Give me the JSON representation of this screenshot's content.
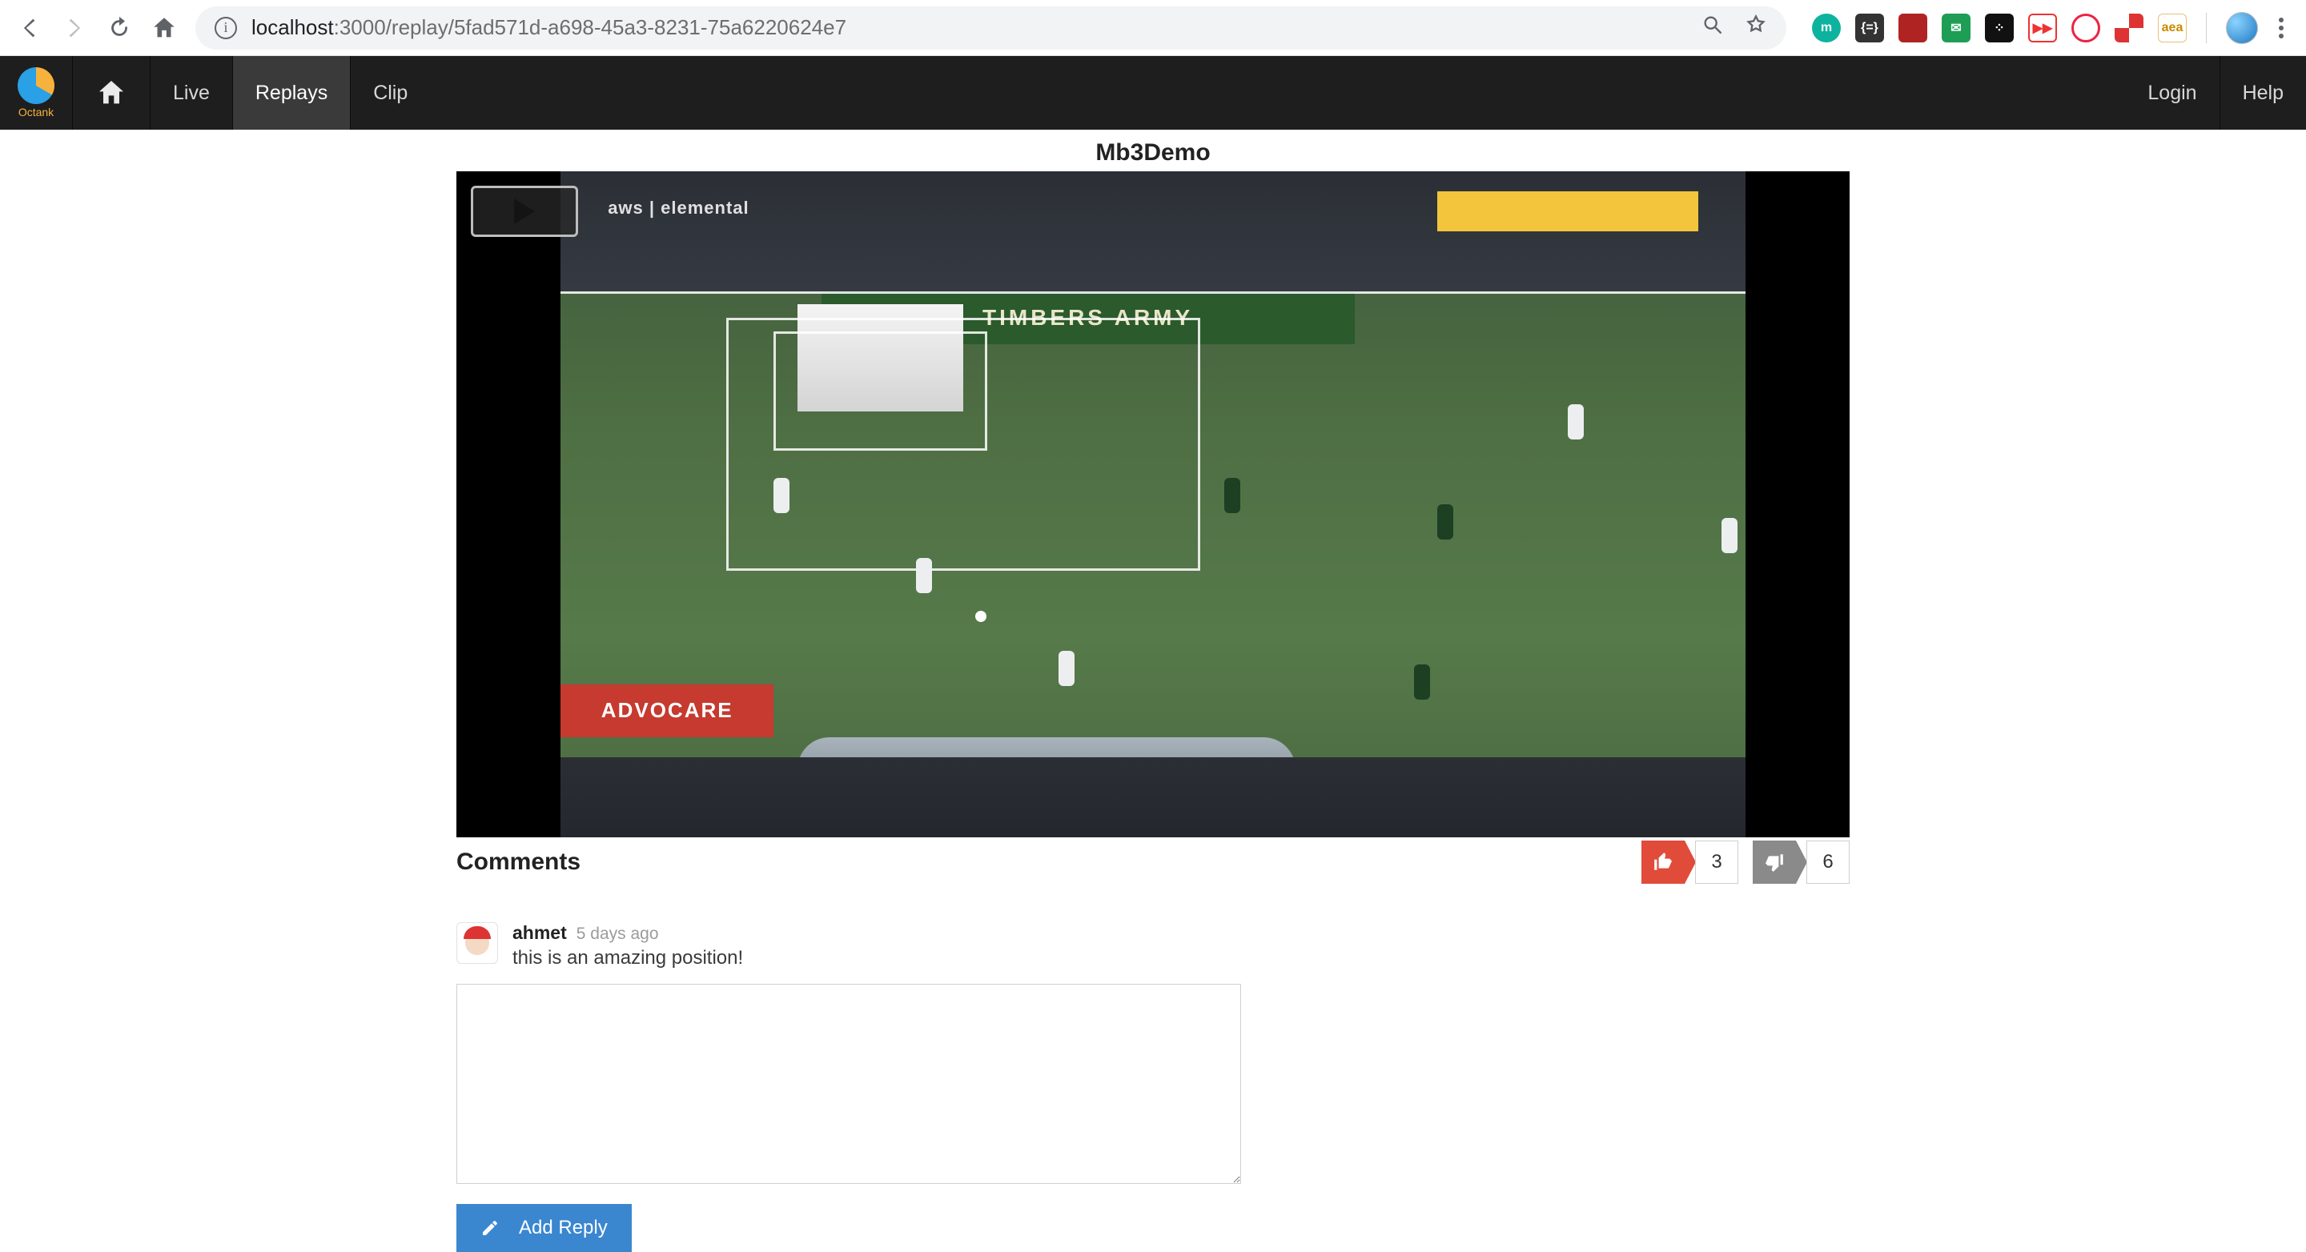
{
  "browser": {
    "url_host": "localhost",
    "url_path": ":3000/replay/5fad571d-a698-45a3-8231-75a6220624e7",
    "extensions": [
      {
        "id": "m",
        "label": "m"
      },
      {
        "id": "brackets",
        "label": "{=}"
      },
      {
        "id": "red1",
        "label": ""
      },
      {
        "id": "mail",
        "label": "✉"
      },
      {
        "id": "dice",
        "label": "⁘"
      },
      {
        "id": "ff",
        "label": "▶▶"
      },
      {
        "id": "circ",
        "label": ""
      },
      {
        "id": "checker",
        "label": ""
      },
      {
        "id": "aea",
        "label": "aea"
      }
    ]
  },
  "nav": {
    "brand": "Octank",
    "items": {
      "live": "Live",
      "replays": "Replays",
      "clip": "Clip"
    },
    "right": {
      "login": "Login",
      "help": "Help"
    },
    "active": "replays"
  },
  "video": {
    "title": "Mb3Demo",
    "watermark": "aws | elemental",
    "banner": "TIMBERS   ARMY",
    "ad_red": "ADVOCARE"
  },
  "reactions": {
    "likes": 3,
    "dislikes": 6
  },
  "comments": {
    "heading": "Comments",
    "list": [
      {
        "author": "ahmet",
        "timestamp": "5 days ago",
        "text": "this is an amazing position!"
      }
    ],
    "add_reply_label": "Add Reply"
  }
}
